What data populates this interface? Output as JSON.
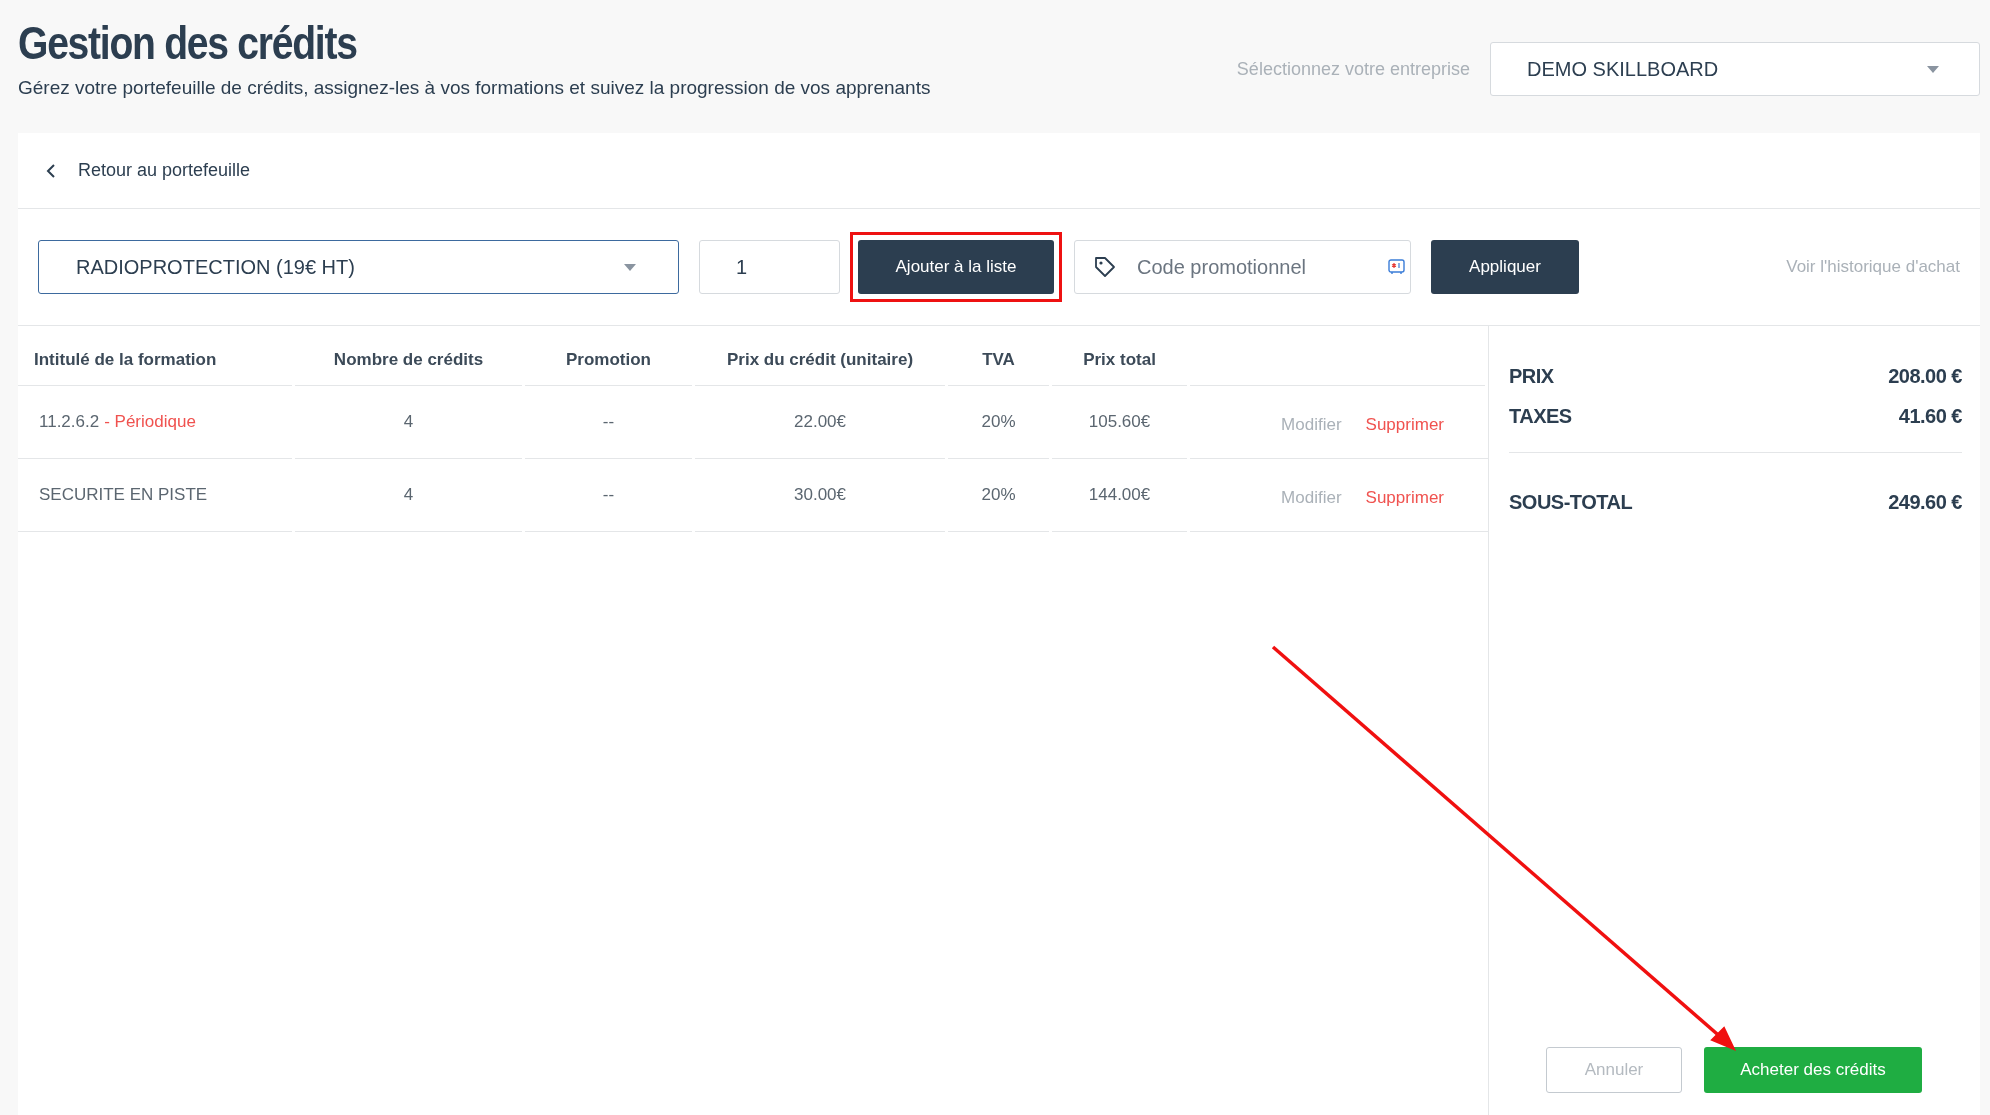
{
  "header": {
    "title": "Gestion des crédits",
    "subtitle": "Gérez votre portefeuille de crédits, assignez-les à vos formations et suivez la progression de vos apprenants",
    "company_label": "Sélectionnez votre entreprise",
    "company_select": "DEMO SKILLBOARD"
  },
  "back_link": "Retour au portefeuille",
  "toolbar": {
    "formation_select": "RADIOPROTECTION (19€ HT)",
    "quantity": "1",
    "add_button": {
      "label": "Ajouter à la liste",
      "highlighted": true
    },
    "promo_placeholder": "Code promotionnel",
    "apply_button": "Appliquer",
    "history_link": "Voir l'historique d'achat"
  },
  "table": {
    "columns": [
      "Intitulé de la formation",
      "Nombre de crédits",
      "Promotion",
      "Prix du crédit (unitaire)",
      "TVA",
      "Prix total"
    ],
    "rows": [
      {
        "title": "11.2.6.2",
        "tag": "- Périodique",
        "credits": "4",
        "promotion": "--",
        "unit_price": "22.00€",
        "vat": "20%",
        "total": "105.60€",
        "edit": "Modifier",
        "delete": "Supprimer"
      },
      {
        "title": "SECURITE EN PISTE",
        "credits": "4",
        "promotion": "--",
        "unit_price": "30.00€",
        "vat": "20%",
        "total": "144.00€",
        "edit": "Modifier",
        "delete": "Supprimer"
      }
    ]
  },
  "summary": {
    "lines": [
      {
        "label": "PRIX",
        "value": "208.00 €"
      },
      {
        "label": "TAXES",
        "value": "41.60 €"
      }
    ],
    "subtotal": {
      "label": "SOUS-TOTAL",
      "value": "249.60 €"
    },
    "cancel_button": "Annuler",
    "buy_button": "Acheter des crédits"
  },
  "annotations": [
    {
      "kind": "arrow"
    }
  ]
}
